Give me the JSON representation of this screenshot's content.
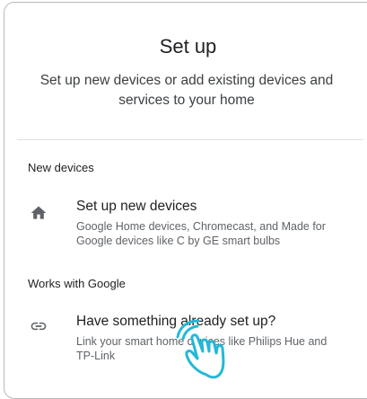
{
  "setup": {
    "title": "Set up",
    "subtitle": "Set up new devices or add existing devices and services to your home"
  },
  "sections": {
    "new_devices": {
      "label": "New devices",
      "item": {
        "icon": "home-icon",
        "title": "Set up new devices",
        "description": "Google Home devices, Chromecast, and Made for Google devices like C by GE smart bulbs"
      }
    },
    "works_with_google": {
      "label": "Works with Google",
      "item": {
        "icon": "link-icon",
        "title": "Have something already set up?",
        "description": "Link your smart home devices like Philips Hue and TP-Link"
      }
    }
  },
  "colors": {
    "text": "#202124",
    "secondary": "#5f6368",
    "pointer_accent": "#22b8d6"
  }
}
